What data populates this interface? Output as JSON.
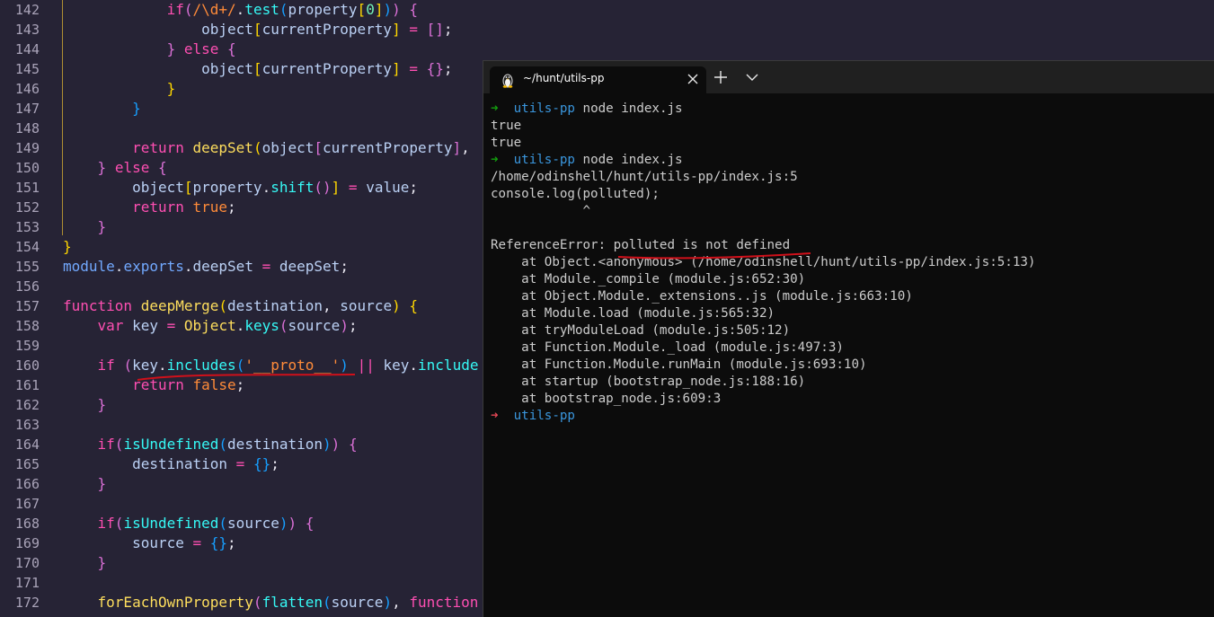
{
  "editor": {
    "line_numbers": [
      "142",
      "143",
      "144",
      "145",
      "146",
      "147",
      "148",
      "149",
      "150",
      "151",
      "152",
      "153",
      "154",
      "155",
      "156",
      "157",
      "158",
      "159",
      "160",
      "161",
      "162",
      "163",
      "164",
      "165",
      "166",
      "167",
      "168",
      "169",
      "170",
      "171",
      "172"
    ],
    "lines": [
      {
        "indent": "            ",
        "tokens": [
          [
            "k",
            "if"
          ],
          [
            "b2",
            "("
          ],
          [
            "s",
            "/\\d+/"
          ],
          [
            "pl",
            "."
          ],
          [
            "f",
            "test"
          ],
          [
            "b3",
            "("
          ],
          [
            "id",
            "property"
          ],
          [
            "b1",
            "["
          ],
          [
            "v",
            "0"
          ],
          [
            "b1",
            "]"
          ],
          [
            "b3",
            ")"
          ],
          [
            "b2",
            ")"
          ],
          [
            "pl",
            " "
          ],
          [
            "b2",
            "{"
          ]
        ]
      },
      {
        "indent": "                ",
        "tokens": [
          [
            "id",
            "object"
          ],
          [
            "b1",
            "["
          ],
          [
            "id",
            "currentProperty"
          ],
          [
            "b1",
            "]"
          ],
          [
            "pl",
            " "
          ],
          [
            "k",
            "="
          ],
          [
            "pl",
            " "
          ],
          [
            "b2",
            "[]"
          ],
          [
            "pl",
            ";"
          ]
        ]
      },
      {
        "indent": "            ",
        "tokens": [
          [
            "b2",
            "}"
          ],
          [
            "pl",
            " "
          ],
          [
            "k",
            "else"
          ],
          [
            "pl",
            " "
          ],
          [
            "b2",
            "{"
          ]
        ]
      },
      {
        "indent": "                ",
        "tokens": [
          [
            "id",
            "object"
          ],
          [
            "b1",
            "["
          ],
          [
            "id",
            "currentProperty"
          ],
          [
            "b1",
            "]"
          ],
          [
            "pl",
            " "
          ],
          [
            "k",
            "="
          ],
          [
            "pl",
            " "
          ],
          [
            "b2",
            "{}"
          ],
          [
            "pl",
            ";"
          ]
        ]
      },
      {
        "indent": "            ",
        "tokens": [
          [
            "b1",
            "}"
          ]
        ]
      },
      {
        "indent": "        ",
        "tokens": [
          [
            "b3",
            "}"
          ]
        ]
      },
      {
        "indent": "",
        "tokens": []
      },
      {
        "indent": "        ",
        "tokens": [
          [
            "k",
            "return"
          ],
          [
            "pl",
            " "
          ],
          [
            "fy",
            "deepSet"
          ],
          [
            "b1",
            "("
          ],
          [
            "id",
            "object"
          ],
          [
            "b2",
            "["
          ],
          [
            "id",
            "currentProperty"
          ],
          [
            "b2",
            "]"
          ],
          [
            "pl",
            ","
          ]
        ]
      },
      {
        "indent": "    ",
        "tokens": [
          [
            "b2",
            "}"
          ],
          [
            "pl",
            " "
          ],
          [
            "k",
            "else"
          ],
          [
            "pl",
            " "
          ],
          [
            "b2",
            "{"
          ]
        ]
      },
      {
        "indent": "        ",
        "tokens": [
          [
            "id",
            "object"
          ],
          [
            "b1",
            "["
          ],
          [
            "id",
            "property"
          ],
          [
            "pl",
            "."
          ],
          [
            "f",
            "shift"
          ],
          [
            "b2",
            "()"
          ],
          [
            "b1",
            "]"
          ],
          [
            "pl",
            " "
          ],
          [
            "k",
            "="
          ],
          [
            "pl",
            " "
          ],
          [
            "id",
            "value"
          ],
          [
            "pl",
            ";"
          ]
        ]
      },
      {
        "indent": "        ",
        "tokens": [
          [
            "k",
            "return"
          ],
          [
            "pl",
            " "
          ],
          [
            "s",
            "true"
          ],
          [
            "pl",
            ";"
          ]
        ]
      },
      {
        "indent": "    ",
        "tokens": [
          [
            "b2",
            "}"
          ]
        ]
      },
      {
        "indent": "",
        "tokens": [
          [
            "b1",
            "}"
          ]
        ]
      },
      {
        "indent": "",
        "tokens": [
          [
            "m",
            "module"
          ],
          [
            "pl",
            "."
          ],
          [
            "m",
            "exports"
          ],
          [
            "pl",
            "."
          ],
          [
            "id",
            "deepSet"
          ],
          [
            "pl",
            " "
          ],
          [
            "k",
            "="
          ],
          [
            "pl",
            " "
          ],
          [
            "id",
            "deepSet"
          ],
          [
            "pl",
            ";"
          ]
        ]
      },
      {
        "indent": "",
        "tokens": []
      },
      {
        "indent": "",
        "tokens": [
          [
            "k",
            "function"
          ],
          [
            "pl",
            " "
          ],
          [
            "fy",
            "deepMerge"
          ],
          [
            "b1",
            "("
          ],
          [
            "id",
            "destination"
          ],
          [
            "pl",
            ", "
          ],
          [
            "id",
            "source"
          ],
          [
            "b1",
            ")"
          ],
          [
            "pl",
            " "
          ],
          [
            "b1",
            "{"
          ]
        ]
      },
      {
        "indent": "    ",
        "tokens": [
          [
            "k",
            "var"
          ],
          [
            "pl",
            " "
          ],
          [
            "id",
            "key"
          ],
          [
            "pl",
            " "
          ],
          [
            "k",
            "="
          ],
          [
            "pl",
            " "
          ],
          [
            "fy",
            "Object"
          ],
          [
            "pl",
            "."
          ],
          [
            "f",
            "keys"
          ],
          [
            "b2",
            "("
          ],
          [
            "id",
            "source"
          ],
          [
            "b2",
            ")"
          ],
          [
            "pl",
            ";"
          ]
        ]
      },
      {
        "indent": "",
        "tokens": []
      },
      {
        "indent": "    ",
        "tokens": [
          [
            "k",
            "if"
          ],
          [
            "pl",
            " "
          ],
          [
            "b2",
            "("
          ],
          [
            "id",
            "key"
          ],
          [
            "pl",
            "."
          ],
          [
            "f",
            "includes"
          ],
          [
            "b3",
            "("
          ],
          [
            "s",
            "'__proto__'"
          ],
          [
            "b3",
            ")"
          ],
          [
            "pl",
            " "
          ],
          [
            "k",
            "||"
          ],
          [
            "pl",
            " "
          ],
          [
            "id",
            "key"
          ],
          [
            "pl",
            "."
          ],
          [
            "f",
            "include"
          ]
        ]
      },
      {
        "indent": "        ",
        "tokens": [
          [
            "k",
            "return"
          ],
          [
            "pl",
            " "
          ],
          [
            "s",
            "false"
          ],
          [
            "pl",
            ";"
          ]
        ]
      },
      {
        "indent": "    ",
        "tokens": [
          [
            "b2",
            "}"
          ]
        ]
      },
      {
        "indent": "",
        "tokens": []
      },
      {
        "indent": "    ",
        "tokens": [
          [
            "k",
            "if"
          ],
          [
            "b2",
            "("
          ],
          [
            "f",
            "isUndefined"
          ],
          [
            "b3",
            "("
          ],
          [
            "id",
            "destination"
          ],
          [
            "b3",
            ")"
          ],
          [
            "b2",
            ")"
          ],
          [
            "pl",
            " "
          ],
          [
            "b2",
            "{"
          ]
        ]
      },
      {
        "indent": "        ",
        "tokens": [
          [
            "id",
            "destination"
          ],
          [
            "pl",
            " "
          ],
          [
            "k",
            "="
          ],
          [
            "pl",
            " "
          ],
          [
            "b3",
            "{}"
          ],
          [
            "pl",
            ";"
          ]
        ]
      },
      {
        "indent": "    ",
        "tokens": [
          [
            "b2",
            "}"
          ]
        ]
      },
      {
        "indent": "",
        "tokens": []
      },
      {
        "indent": "    ",
        "tokens": [
          [
            "k",
            "if"
          ],
          [
            "b2",
            "("
          ],
          [
            "f",
            "isUndefined"
          ],
          [
            "b3",
            "("
          ],
          [
            "id",
            "source"
          ],
          [
            "b3",
            ")"
          ],
          [
            "b2",
            ")"
          ],
          [
            "pl",
            " "
          ],
          [
            "b2",
            "{"
          ]
        ]
      },
      {
        "indent": "        ",
        "tokens": [
          [
            "id",
            "source"
          ],
          [
            "pl",
            " "
          ],
          [
            "k",
            "="
          ],
          [
            "pl",
            " "
          ],
          [
            "b3",
            "{}"
          ],
          [
            "pl",
            ";"
          ]
        ]
      },
      {
        "indent": "    ",
        "tokens": [
          [
            "b2",
            "}"
          ]
        ]
      },
      {
        "indent": "",
        "tokens": []
      },
      {
        "indent": "    ",
        "tokens": [
          [
            "fy",
            "forEachOwnProperty"
          ],
          [
            "b2",
            "("
          ],
          [
            "f",
            "flatten"
          ],
          [
            "b3",
            "("
          ],
          [
            "id",
            "source"
          ],
          [
            "b3",
            ")"
          ],
          [
            "pl",
            ", "
          ],
          [
            "k",
            "function"
          ]
        ]
      }
    ]
  },
  "terminal": {
    "tab_title": "~/hunt/utils-pp",
    "tab_icon": "linux-penguin-icon",
    "lines": [
      {
        "type": "prompt",
        "arrow": "➜",
        "dir": "utils-pp",
        "cmd": "node index.js"
      },
      {
        "type": "text",
        "text": "true"
      },
      {
        "type": "text",
        "text": "true"
      },
      {
        "type": "prompt",
        "arrow": "➜",
        "dir": "utils-pp",
        "cmd": "node index.js"
      },
      {
        "type": "text",
        "text": "/home/odinshell/hunt/utils-pp/index.js:5"
      },
      {
        "type": "text",
        "text": "console.log(polluted);"
      },
      {
        "type": "text",
        "text": "            ^"
      },
      {
        "type": "text",
        "text": ""
      },
      {
        "type": "text",
        "text": "ReferenceError: polluted is not defined"
      },
      {
        "type": "text",
        "text": "    at Object.<anonymous> (/home/odinshell/hunt/utils-pp/index.js:5:13)"
      },
      {
        "type": "text",
        "text": "    at Module._compile (module.js:652:30)"
      },
      {
        "type": "text",
        "text": "    at Object.Module._extensions..js (module.js:663:10)"
      },
      {
        "type": "text",
        "text": "    at Module.load (module.js:565:32)"
      },
      {
        "type": "text",
        "text": "    at tryModuleLoad (module.js:505:12)"
      },
      {
        "type": "text",
        "text": "    at Function.Module._load (module.js:497:3)"
      },
      {
        "type": "text",
        "text": "    at Function.Module.runMain (module.js:693:10)"
      },
      {
        "type": "text",
        "text": "    at startup (bootstrap_node.js:188:16)"
      },
      {
        "type": "text",
        "text": "    at bootstrap_node.js:609:3"
      },
      {
        "type": "prompt_err",
        "arrow": "➜",
        "dir": "utils-pp",
        "cmd": ""
      }
    ]
  },
  "colors": {
    "editor_bg": "#262335",
    "terminal_bg": "#0c0c0c",
    "annotation_red": "#d0101a"
  }
}
